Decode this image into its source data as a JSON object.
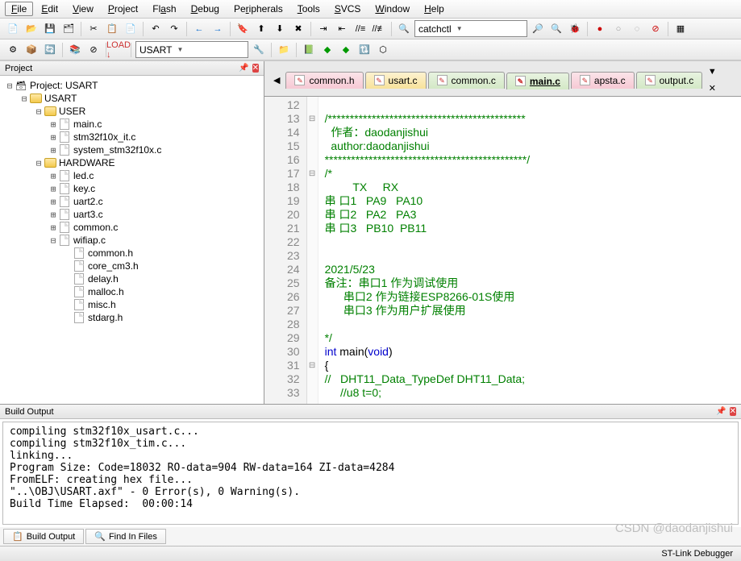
{
  "menu": [
    "File",
    "Edit",
    "View",
    "Project",
    "Flash",
    "Debug",
    "Peripherals",
    "Tools",
    "SVCS",
    "Window",
    "Help"
  ],
  "toolbar1": {
    "combo": "catchctl"
  },
  "toolbar2": {
    "target": "USART"
  },
  "project": {
    "title": "Project",
    "root": "Project: USART",
    "tree": [
      {
        "label": "USART",
        "depth": 1,
        "type": "folder",
        "open": true
      },
      {
        "label": "USER",
        "depth": 2,
        "type": "folder",
        "open": true
      },
      {
        "label": "main.c",
        "depth": 3,
        "type": "file",
        "plus": true
      },
      {
        "label": "stm32f10x_it.c",
        "depth": 3,
        "type": "file",
        "plus": true
      },
      {
        "label": "system_stm32f10x.c",
        "depth": 3,
        "type": "file",
        "plus": true
      },
      {
        "label": "HARDWARE",
        "depth": 2,
        "type": "folder",
        "open": true
      },
      {
        "label": "led.c",
        "depth": 3,
        "type": "file",
        "plus": true
      },
      {
        "label": "key.c",
        "depth": 3,
        "type": "file",
        "plus": true
      },
      {
        "label": "uart2.c",
        "depth": 3,
        "type": "file",
        "plus": true
      },
      {
        "label": "uart3.c",
        "depth": 3,
        "type": "file",
        "plus": true
      },
      {
        "label": "common.c",
        "depth": 3,
        "type": "file",
        "plus": true
      },
      {
        "label": "wifiap.c",
        "depth": 3,
        "type": "file",
        "open": true
      },
      {
        "label": "common.h",
        "depth": 4,
        "type": "header"
      },
      {
        "label": "core_cm3.h",
        "depth": 4,
        "type": "header"
      },
      {
        "label": "delay.h",
        "depth": 4,
        "type": "header"
      },
      {
        "label": "malloc.h",
        "depth": 4,
        "type": "header"
      },
      {
        "label": "misc.h",
        "depth": 4,
        "type": "header"
      },
      {
        "label": "stdarg.h",
        "depth": 4,
        "type": "header"
      }
    ]
  },
  "tabs": [
    {
      "label": "common.h",
      "cls": "pink-t"
    },
    {
      "label": "usart.c",
      "cls": "yellow-t"
    },
    {
      "label": "common.c",
      "cls": "green-t"
    },
    {
      "label": "main.c",
      "cls": "green-t",
      "active": true,
      "underline": true
    },
    {
      "label": "apsta.c",
      "cls": "pink-t"
    },
    {
      "label": "output.c",
      "cls": "green-t"
    }
  ],
  "code": {
    "start": 12,
    "lines": [
      {
        "t": "",
        "fold": ""
      },
      {
        "t": "/*********************************************",
        "cls": "c-green",
        "fold": "⊟"
      },
      {
        "t": "  作者：daodanjishui",
        "cls": "c-green"
      },
      {
        "t": "  author:daodanjishui",
        "cls": "c-green"
      },
      {
        "t": "**********************************************/",
        "cls": "c-green"
      },
      {
        "t": "/*",
        "cls": "c-green",
        "fold": "⊟"
      },
      {
        "t": "         TX     RX",
        "cls": "c-green"
      },
      {
        "t": "串 口1   PA9   PA10",
        "cls": "c-green"
      },
      {
        "t": "串 口2   PA2   PA3",
        "cls": "c-green"
      },
      {
        "t": "串 口3   PB10  PB11",
        "cls": "c-green"
      },
      {
        "t": "",
        "cls": "c-green"
      },
      {
        "t": "",
        "cls": "c-green"
      },
      {
        "t": "2021/5/23",
        "cls": "c-green"
      },
      {
        "t": "备注：串口1 作为调试使用",
        "cls": "c-green"
      },
      {
        "t": "      串口2 作为链接ESP8266-01S使用",
        "cls": "c-green"
      },
      {
        "t": "      串口3 作为用户扩展使用",
        "cls": "c-green"
      },
      {
        "t": "",
        "cls": "c-green"
      },
      {
        "t": "*/",
        "cls": "c-green"
      },
      {
        "raw": "<span class=\"c-blue\">int</span> main(<span class=\"c-blue\">void</span>)"
      },
      {
        "t": "{",
        "fold": "⊟"
      },
      {
        "t": "//   DHT11_Data_TypeDef DHT11_Data;",
        "cls": "c-green"
      },
      {
        "t": "     //u8 t=0;",
        "cls": "c-green"
      }
    ]
  },
  "build": {
    "title": "Build Output",
    "text": "compiling stm32f10x_usart.c...\ncompiling stm32f10x_tim.c...\nlinking...\nProgram Size: Code=18032 RO-data=904 RW-data=164 ZI-data=4284\nFromELF: creating hex file...\n\"..\\OBJ\\USART.axf\" - 0 Error(s), 0 Warning(s).\nBuild Time Elapsed:  00:00:14"
  },
  "bottom_tabs": [
    "Build Output",
    "Find In Files"
  ],
  "status": {
    "debugger": "ST-Link Debugger"
  },
  "watermark": "CSDN @daodanjishui"
}
